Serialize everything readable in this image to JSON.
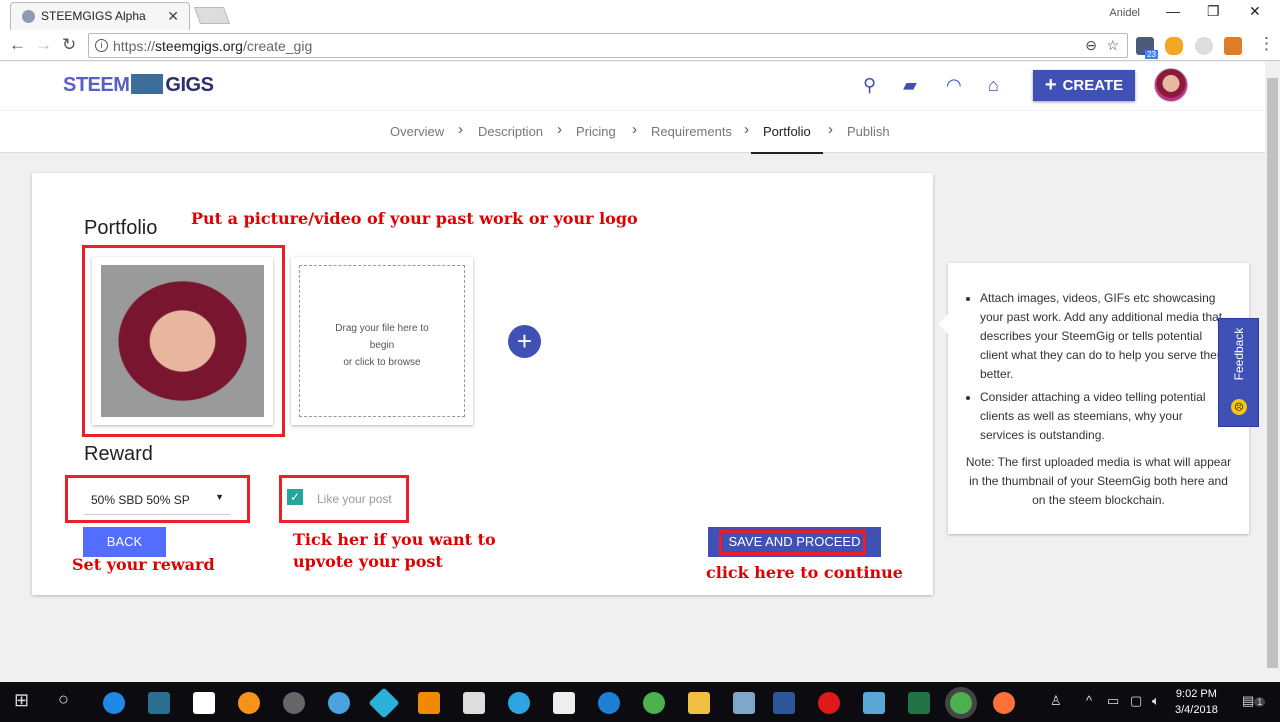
{
  "browser": {
    "tab_title": "STEEMGIGS Alpha",
    "user": "Anidel",
    "url_scheme": "https://",
    "url_domain": "steemgigs.org",
    "url_path": "/create_gig",
    "ext_badge": "23"
  },
  "header": {
    "logo_left": "STEEM",
    "logo_right": "GIGS",
    "create_label": "CREATE"
  },
  "steps": [
    {
      "label": "Overview"
    },
    {
      "label": "Description"
    },
    {
      "label": "Pricing"
    },
    {
      "label": "Requirements"
    },
    {
      "label": "Portfolio"
    },
    {
      "label": "Publish"
    }
  ],
  "form": {
    "portfolio_title": "Portfolio",
    "drop_line1": "Drag your file here to",
    "drop_line2": "begin",
    "drop_line3": "or click to browse",
    "reward_title": "Reward",
    "reward_value": "50% SBD 50% SP",
    "like_label": "Like your post",
    "back_label": "BACK",
    "save_label": "SAVE AND PROCEED"
  },
  "annotations": {
    "top": "Put a picture/video of your past work or your logo",
    "reward": "Set your reward",
    "tick1": "Tick her if you want to",
    "tick2": "upvote your post",
    "continue": "click here to continue"
  },
  "help": {
    "bullets": [
      "Attach images, videos, GIFs etc showcasing your past work. Add any additional media that describes your SteemGig or tells potential client what they can do to help you serve them better.",
      "Consider attaching a video telling potential clients as well as steemians, why your services is outstanding."
    ],
    "note": "Note: The first uploaded media is what will appear in the thumbnail of your SteemGig both here and on the steem blockchain."
  },
  "feedback": "Feedback",
  "taskbar": {
    "time": "9:02 PM",
    "date": "3/4/2018",
    "notifications": "1"
  }
}
